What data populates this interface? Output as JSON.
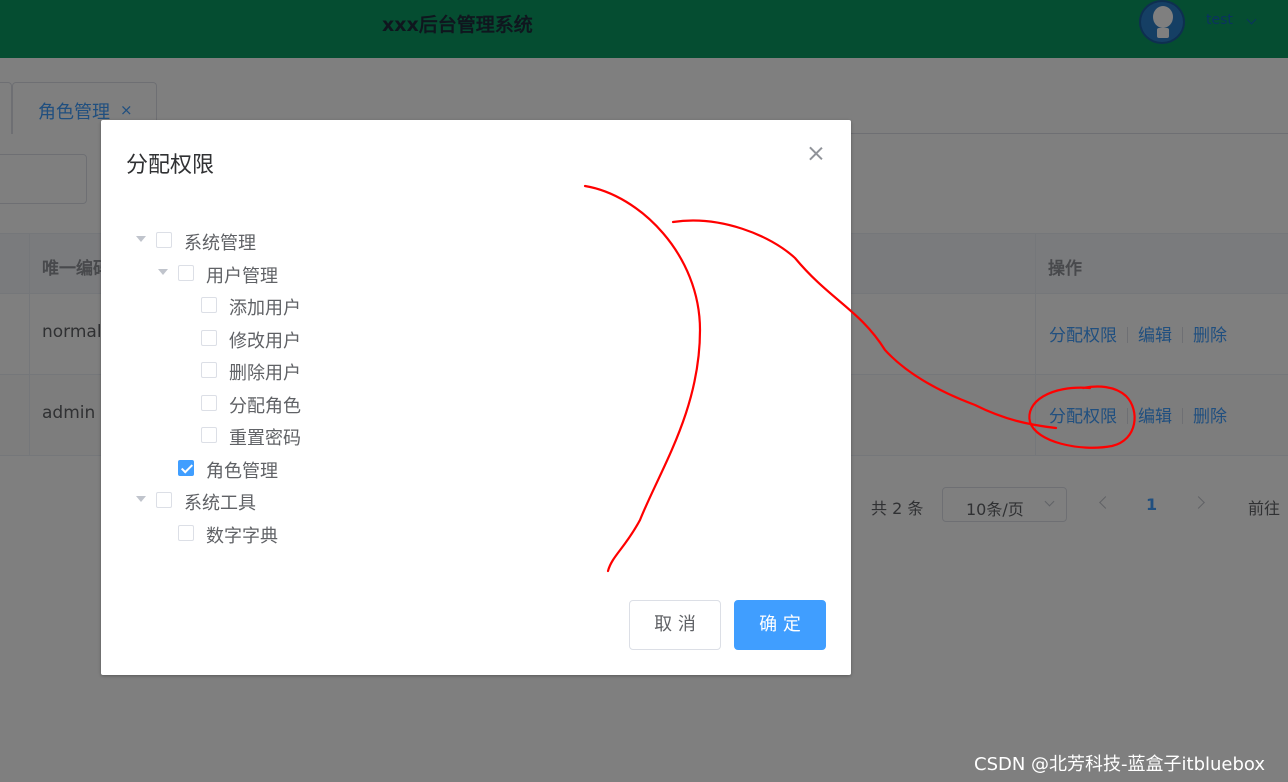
{
  "header": {
    "title": "xxx后台管理系统",
    "user_name": "test",
    "brand_color": "#0b9a63"
  },
  "tabs": [
    {
      "label": "角色管理",
      "active": true
    }
  ],
  "table": {
    "columns": {
      "code": "唯一编码",
      "operations": "操作"
    },
    "rows": [
      {
        "code": "normal",
        "ops": [
          "分配权限",
          "编辑",
          "删除"
        ]
      },
      {
        "code": "admin",
        "ops": [
          "分配权限",
          "编辑",
          "删除"
        ]
      }
    ]
  },
  "pagination": {
    "total_text": "共 2 条",
    "page_size": "10条/页",
    "current_page": "1",
    "goto_label": "前往"
  },
  "dialog": {
    "title": "分配权限",
    "tree": [
      {
        "label": "系统管理",
        "checked": false
      },
      {
        "label": "用户管理",
        "checked": false
      },
      {
        "label": "添加用户",
        "checked": false
      },
      {
        "label": "修改用户",
        "checked": false
      },
      {
        "label": "删除用户",
        "checked": false
      },
      {
        "label": "分配角色",
        "checked": false
      },
      {
        "label": "重置密码",
        "checked": false
      },
      {
        "label": "角色管理",
        "checked": true
      },
      {
        "label": "系统工具",
        "checked": false
      },
      {
        "label": "数字字典",
        "checked": false
      }
    ],
    "cancel_label": "取 消",
    "confirm_label": "确 定"
  },
  "watermark": "CSDN @北芳科技-蓝盒子itbluebox",
  "colors": {
    "primary": "#409eff",
    "annotation": "#ff0000"
  },
  "icons": [
    "avatar-bulb-icon",
    "chevron-down-icon",
    "close-icon",
    "tree-expand-icon",
    "chevron-left-icon",
    "chevron-right-icon"
  ]
}
